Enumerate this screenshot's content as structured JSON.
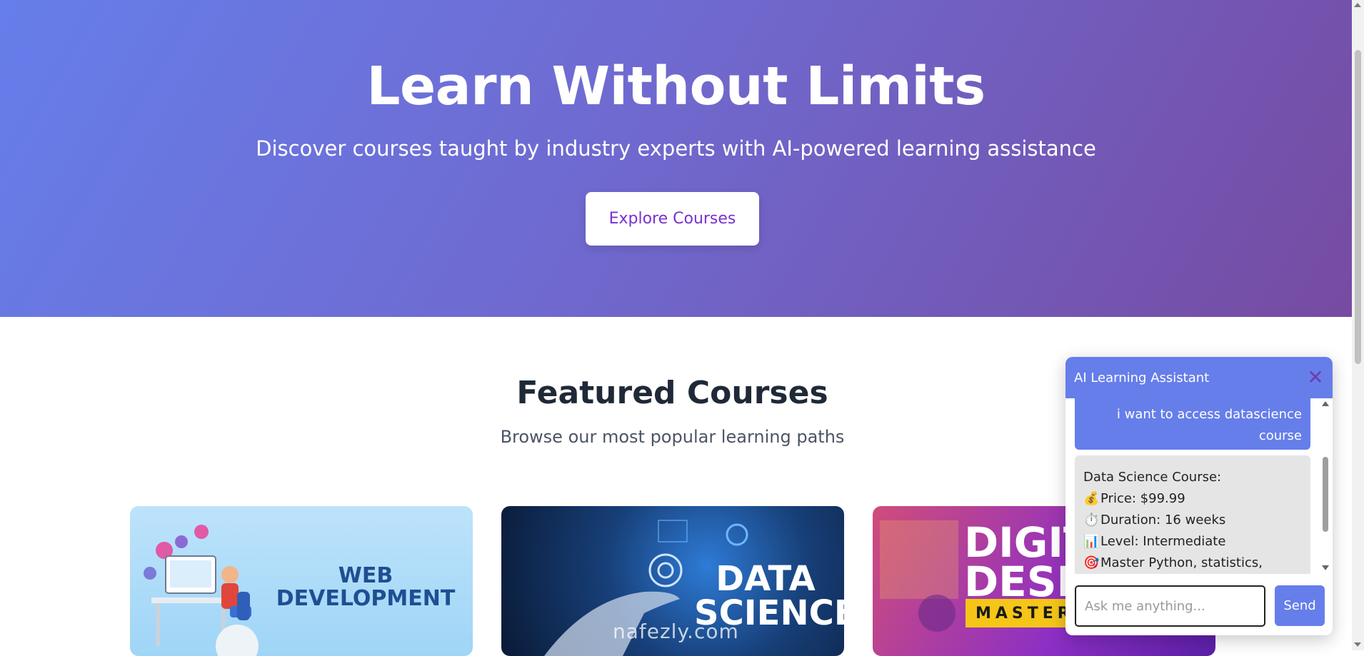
{
  "hero": {
    "title": "Learn Without Limits",
    "subtitle": "Discover courses taught by industry experts with AI-powered learning assistance",
    "cta_label": "Explore Courses"
  },
  "featured": {
    "title": "Featured Courses",
    "subtitle": "Browse our most popular learning paths",
    "courses": [
      {
        "image_text": "WEB DEVELOPMENT"
      },
      {
        "image_text": "DATA SCIENCE"
      },
      {
        "image_text": "DIGIT DESIG",
        "banner": "MASTERC"
      }
    ]
  },
  "watermark": "nafezly.com",
  "chat": {
    "title": "AI Learning Assistant",
    "close_icon": "close-icon",
    "user_message": "i want to access datascience course",
    "bot_message": {
      "heading": "Data Science Course:",
      "lines": [
        {
          "emoji": "💰",
          "text": "Price: $99.99"
        },
        {
          "emoji": "⏱️",
          "text": "Duration: 16 weeks"
        },
        {
          "emoji": "📊",
          "text": "Level: Intermediate"
        },
        {
          "emoji": "🎯",
          "text": "Master Python, statistics,"
        }
      ]
    },
    "input_placeholder": "Ask me anything...",
    "send_label": "Send"
  },
  "colors": {
    "accent": "#667eea",
    "hero_gradient_end": "#764ba2",
    "cta_text": "#7b2fd0"
  }
}
